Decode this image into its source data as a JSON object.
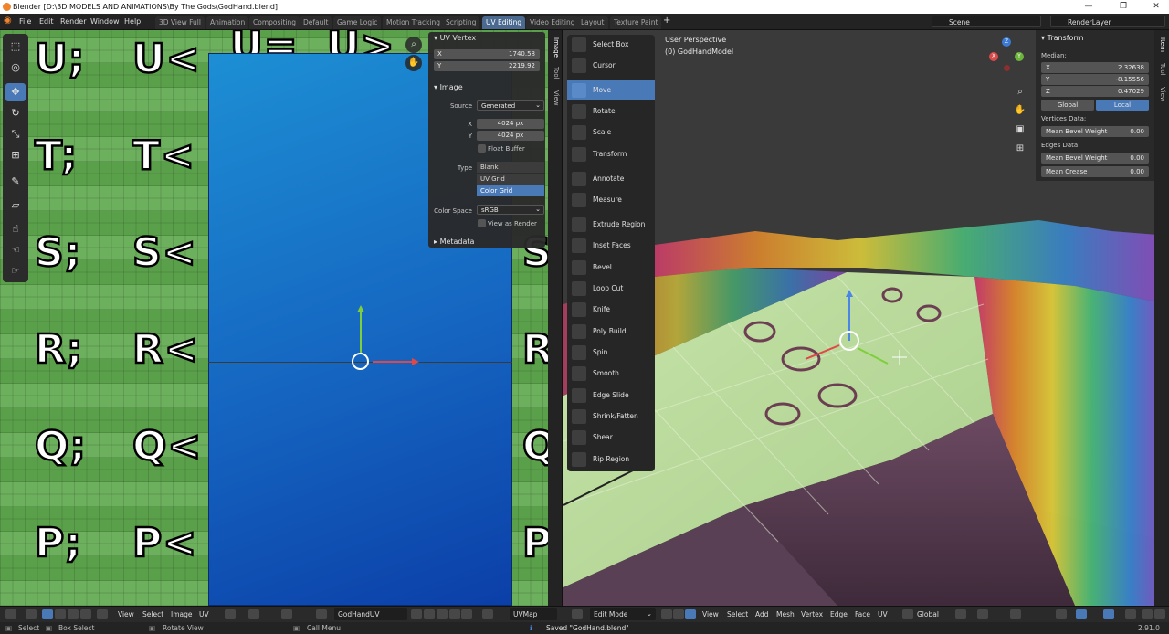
{
  "window": {
    "title": "Blender [D:\\3D MODELS AND ANIMATIONS\\By The Gods\\GodHand.blend]",
    "minimize": "—",
    "maximize": "❐",
    "close": "✕"
  },
  "menubar": {
    "items": [
      "File",
      "Edit",
      "Render",
      "Window",
      "Help"
    ]
  },
  "workspace_tabs": [
    {
      "label": "3D View Full",
      "active": false
    },
    {
      "label": "Animation",
      "active": false
    },
    {
      "label": "Compositing",
      "active": false
    },
    {
      "label": "Default",
      "active": false
    },
    {
      "label": "Game Logic",
      "active": false
    },
    {
      "label": "Motion Tracking",
      "active": false
    },
    {
      "label": "Scripting",
      "active": false
    },
    {
      "label": "UV Editing",
      "active": true
    },
    {
      "label": "Video Editing",
      "active": false
    },
    {
      "label": "Layout",
      "active": false
    },
    {
      "label": "Texture Paint",
      "active": false
    }
  ],
  "add_tab": "+",
  "scene": {
    "value": "Scene"
  },
  "render_layer": {
    "value": "RenderLayer"
  },
  "uv_editor": {
    "glyphs_left": [
      "U;",
      "T;",
      "S;",
      "R;",
      "Q;",
      "P;"
    ],
    "glyphs_mid": [
      "U<",
      "T<",
      "S<",
      "R<",
      "Q<",
      "P<"
    ],
    "glyphs_top": [
      "U=",
      "U>"
    ],
    "glyphs_right": [
      "S",
      "R",
      "Q",
      "P"
    ],
    "side_tabs": [
      "Image",
      "Tool",
      "View"
    ],
    "panel": {
      "uv_vertex_header": "UV Vertex",
      "x_label": "X",
      "x_value": "1740.58",
      "y_label": "Y",
      "y_value": "2219.92",
      "image_header": "Image",
      "source_label": "Source",
      "source_value": "Generated",
      "size_x_label": "X",
      "size_x_value": "4024 px",
      "size_y_label": "Y",
      "size_y_value": "4024 px",
      "float_buffer": "Float Buffer",
      "type_label": "Type",
      "type_options": [
        "Blank",
        "UV Grid",
        "Color Grid"
      ],
      "type_selected": "Color Grid",
      "color_space_label": "Color Space",
      "color_space_value": "sRGB",
      "view_as_render": "View as Render",
      "metadata_header": "Metadata"
    }
  },
  "viewport": {
    "perspective": "User Perspective",
    "object": "(0) GodHandModel",
    "side_tabs": [
      "Item",
      "Tool",
      "View"
    ],
    "axes": {
      "x": "X",
      "y": "Y",
      "z": "Z"
    }
  },
  "tool_menu": [
    {
      "label": "Select Box",
      "active": false
    },
    {
      "label": "Cursor",
      "active": false
    },
    {
      "label": "Move",
      "active": true
    },
    {
      "label": "Rotate",
      "active": false
    },
    {
      "label": "Scale",
      "active": false
    },
    {
      "label": "Transform",
      "active": false
    },
    {
      "label": "Annotate",
      "active": false
    },
    {
      "label": "Measure",
      "active": false
    },
    {
      "label": "Extrude Region",
      "active": false
    },
    {
      "label": "Inset Faces",
      "active": false
    },
    {
      "label": "Bevel",
      "active": false
    },
    {
      "label": "Loop Cut",
      "active": false
    },
    {
      "label": "Knife",
      "active": false
    },
    {
      "label": "Poly Build",
      "active": false
    },
    {
      "label": "Spin",
      "active": false
    },
    {
      "label": "Smooth",
      "active": false
    },
    {
      "label": "Edge Slide",
      "active": false
    },
    {
      "label": "Shrink/Fatten",
      "active": false
    },
    {
      "label": "Shear",
      "active": false
    },
    {
      "label": "Rip Region",
      "active": false
    }
  ],
  "transform_panel": {
    "header": "Transform",
    "median_label": "Median:",
    "x_label": "X",
    "x_value": "2.32638",
    "y_label": "Y",
    "y_value": "-8.15556",
    "z_label": "Z",
    "z_value": "0.47029",
    "global": "Global",
    "local": "Local",
    "vertices_data": "Vertices Data:",
    "vertex_bevel_label": "Mean Bevel Weight",
    "vertex_bevel_value": "0.00",
    "edges_data": "Edges Data:",
    "edge_bevel_label": "Mean Bevel Weight",
    "edge_bevel_value": "0.00",
    "crease_label": "Mean Crease",
    "crease_value": "0.00"
  },
  "uv_header": {
    "menus": [
      "View",
      "Select",
      "Image",
      "UV"
    ],
    "image_name": "GodHandUV",
    "uv_map": "UVMap"
  },
  "viewport_header": {
    "mode": "Edit Mode",
    "menus": [
      "View",
      "Select",
      "Add",
      "Mesh",
      "Vertex",
      "Edge",
      "Face",
      "UV"
    ],
    "orientation": "Global"
  },
  "statusbar": {
    "select": "Select",
    "box_select": "Box Select",
    "rotate_view": "Rotate View",
    "call_menu": "Call Menu",
    "message": "Saved \"GodHand.blend\"",
    "version": "2.91.0"
  },
  "colors": {
    "accent": "#4a79b8",
    "active_tab": "#4a6a8f",
    "uv_background": "#5fa84e",
    "uv_island": "#1565c0"
  }
}
